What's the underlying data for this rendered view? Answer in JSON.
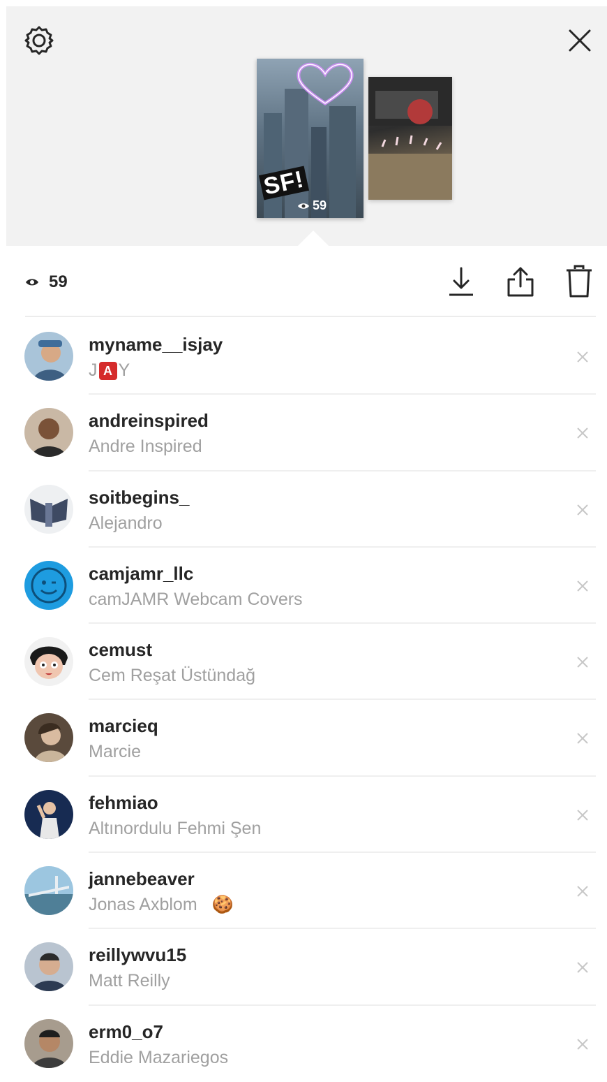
{
  "header": {
    "settings_icon": "gear-icon",
    "close_icon": "close-icon",
    "story_thumbnails": [
      {
        "overlay_text": "SF!",
        "view_count": "59"
      },
      {
        "overlay_text": ""
      }
    ]
  },
  "stats": {
    "view_count": "59",
    "actions": [
      {
        "name": "download",
        "icon": "download-icon"
      },
      {
        "name": "share",
        "icon": "share-icon"
      },
      {
        "name": "delete",
        "icon": "trash-icon"
      }
    ]
  },
  "viewers": [
    {
      "username": "myname__isjay",
      "fullname_pre": "J",
      "fullname_badge": "A",
      "fullname_post": "Y",
      "avatar_color": "#7d9bb5"
    },
    {
      "username": "andreinspired",
      "fullname": "Andre Inspired",
      "avatar_color": "#8a6a4e"
    },
    {
      "username": "soitbegins_",
      "fullname": "Alejandro",
      "avatar_color": "#dfe3e8"
    },
    {
      "username": "camjamr_llc",
      "fullname": "camJAMR Webcam Covers",
      "avatar_color": "#1e9ce0"
    },
    {
      "username": "cemust",
      "fullname": "Cem Reşat Üstündağ",
      "avatar_color": "#3a2b25"
    },
    {
      "username": "marcieq",
      "fullname": "Marcie",
      "avatar_color": "#7a6350"
    },
    {
      "username": "fehmiao",
      "fullname": "Altınordulu Fehmi Şen",
      "avatar_color": "#203a66"
    },
    {
      "username": "jannebeaver",
      "fullname": "Jonas Axblom",
      "fullname_emoji": "🍪",
      "avatar_color": "#79a8c4"
    },
    {
      "username": "reillywvu15",
      "fullname": "Matt Reilly",
      "avatar_color": "#5c6f86"
    },
    {
      "username": "erm0_o7",
      "fullname": "Eddie Mazariegos",
      "avatar_color": "#6a5848"
    }
  ],
  "colors": {
    "header_bg": "#f2f2f2",
    "text_primary": "#262626",
    "text_secondary": "#a0a0a0",
    "divider": "#ececec"
  }
}
